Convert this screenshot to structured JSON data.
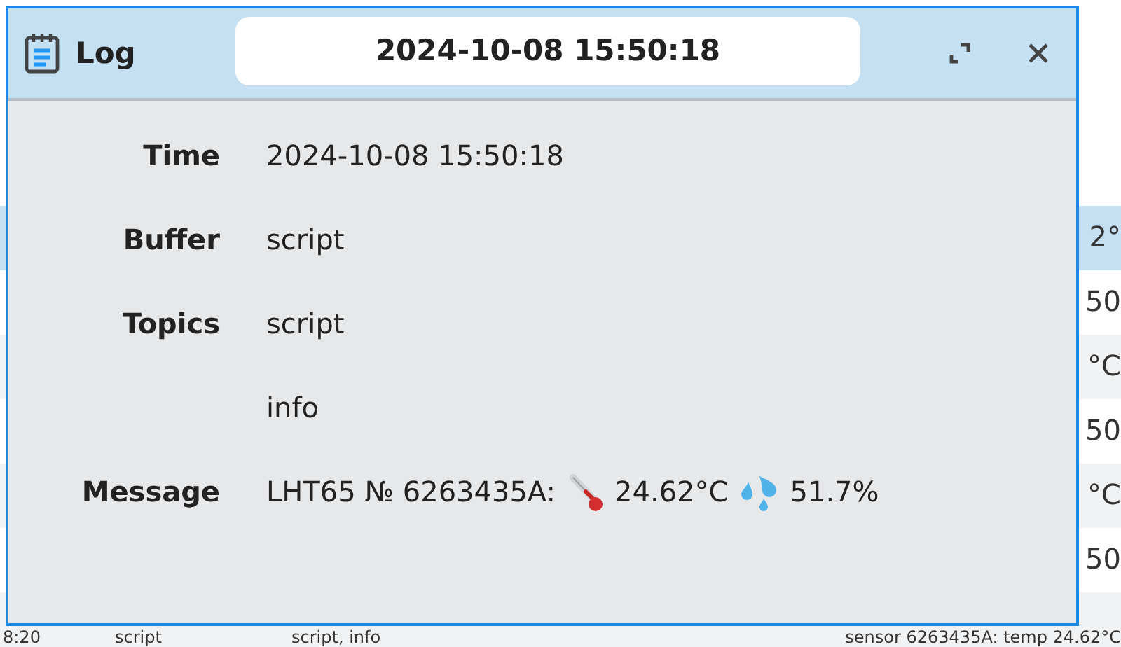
{
  "log_table": {
    "rows": [
      {
        "message": "2°",
        "selected": true
      },
      {
        "message": "50",
        "selected": false
      },
      {
        "message": "°C",
        "selected": false
      },
      {
        "message": "50",
        "selected": false
      },
      {
        "message": "°C",
        "selected": false
      },
      {
        "message": "50",
        "selected": false
      },
      {
        "time": "8:20",
        "buffer": "script",
        "topics": "script, info",
        "message": "sensor 6263435A: temp 24.62°C",
        "selected": false
      }
    ]
  },
  "dialog": {
    "title": "Log",
    "timestamp": "2024-10-08 15:50:18",
    "time": {
      "label": "Time",
      "value": "2024-10-08 15:50:18"
    },
    "buffer": {
      "label": "Buffer",
      "value": "script"
    },
    "topics": {
      "label": "Topics",
      "values": [
        "script",
        "info"
      ]
    },
    "message": {
      "label": "Message",
      "prefix": "LHT65 № 6263435A:",
      "temperature": "24.62°C",
      "humidity": "51.7%"
    }
  }
}
